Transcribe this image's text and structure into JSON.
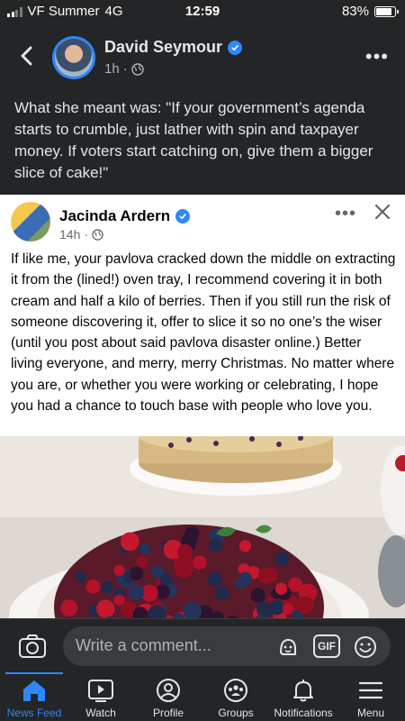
{
  "status_bar": {
    "carrier": "VF Summer",
    "network": "4G",
    "time": "12:59",
    "battery": "83%",
    "battery_level": 0.83
  },
  "post": {
    "author": "David Seymour",
    "time": "1h",
    "separator": "·",
    "text": "What she meant was: \"If your government’s agenda starts to crumble, just lather with spin and taxpayer money. If voters start catching on, give them a bigger slice of cake!\""
  },
  "shared_post": {
    "author": "Jacinda Ardern",
    "time": "14h",
    "separator": "·",
    "text": "If like me, your pavlova cracked down the middle on extracting it from the (lined!) oven tray, I recommend covering it in both cream and half a kilo of berries. Then if you still run the risk of someone discovering it, offer to slice it so no one’s the wiser (until you post about said pavlova disaster online.) Better living everyone, and merry, merry Christmas. No matter where you are, or whether you were working or celebrating, I hope you had a chance to touch base with people who love you."
  },
  "comment_bar": {
    "placeholder": "Write a comment...",
    "gif_label": "GIF"
  },
  "nav": {
    "items": [
      {
        "label": "News Feed",
        "icon": "home-icon",
        "active": true
      },
      {
        "label": "Watch",
        "icon": "watch-icon",
        "active": false
      },
      {
        "label": "Profile",
        "icon": "profile-icon",
        "active": false
      },
      {
        "label": "Groups",
        "icon": "groups-icon",
        "active": false
      },
      {
        "label": "Notifications",
        "icon": "bell-icon",
        "active": false
      },
      {
        "label": "Menu",
        "icon": "menu-icon",
        "active": false
      }
    ]
  },
  "colors": {
    "accent": "#2d88ff",
    "background": "#242526"
  }
}
